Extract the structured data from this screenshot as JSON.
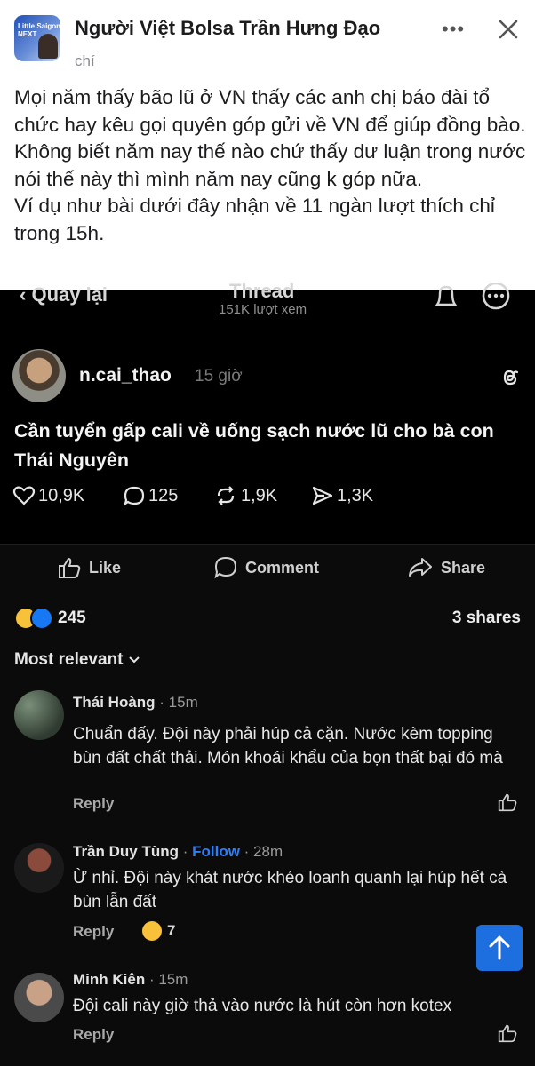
{
  "header": {
    "group_name": "Người Việt Bolsa Trần Hưng Đạo",
    "subtitle": "chí",
    "avatar_text": "Little Saigon NEXT"
  },
  "caption": {
    "p1": "Mọi năm thấy bão lũ ở VN thấy các anh chị báo đài tổ chức  hay kêu gọi quyên góp gửi về VN để giúp đồng bào. Không biết năm nay thế nào chứ thấy dư luận trong nước nói thế này thì mình năm nay cũng k góp nữa.",
    "p2": "Ví dụ như bài dưới đây nhận về 11 ngàn lượt thích chỉ trong 15h."
  },
  "thread": {
    "back_label": "Quay lại",
    "title": "Thread",
    "views": "151K lượt xem",
    "username": "n.cai_thao",
    "time": "15 giờ",
    "post_text": "Cần tuyển gấp cali về uống sạch nước lũ cho bà con Thái Nguyên",
    "likes": "10,9K",
    "comments": "125",
    "reposts": "1,9K",
    "shares": "1,3K"
  },
  "fb_post": {
    "like_label": "Like",
    "comment_label": "Comment",
    "share_label": "Share",
    "reaction_count": "245",
    "shares_text": "3 shares",
    "sort_label": "Most relevant"
  },
  "comments": [
    {
      "name": "Thái Hoàng",
      "time": "15m",
      "text": "Chuẩn đấy. Đội này phải húp cả cặn. Nước kèm topping bùn đất chất thải. Món khoái khẩu của bọn thất bại đó mà",
      "reply_label": "Reply"
    },
    {
      "name": "Trần Duy Tùng",
      "follow_label": "Follow",
      "time": "28m",
      "text": "Ừ nhỉ. Đội này khát nước khéo loanh quanh lại húp hết cà bùn lẫn đất",
      "reply_label": "Reply",
      "reaction_count": "7"
    },
    {
      "name": "Minh Kiên",
      "time": "15m",
      "text": "Đội cali này giờ thả vào nước là hút còn hơn kotex",
      "reply_label": "Reply"
    }
  ],
  "colors": {
    "accent": "#1877f2",
    "follow": "#2d7ff9",
    "haha": "#f7c23a"
  }
}
